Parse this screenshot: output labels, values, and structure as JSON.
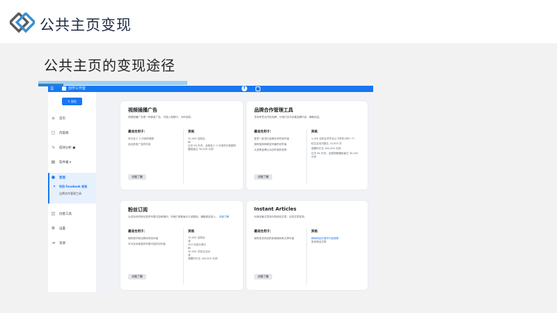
{
  "slide": {
    "header_title": "公共主页变现",
    "page_title": "公共主页的变现途径"
  },
  "app": {
    "brand": "创作工作室",
    "create_button": "发帖",
    "nav": [
      {
        "label": "首页",
        "icon": "home-icon"
      },
      {
        "label": "内容库",
        "icon": "content-library-icon"
      },
      {
        "label": "成效分析 ●",
        "icon": "insights-icon"
      },
      {
        "label": "软件箱 ▾",
        "icon": "toolbox-icon"
      },
      {
        "label": "变现",
        "icon": "monetization-icon"
      },
      {
        "label": "创意工具",
        "icon": "creative-tools-icon"
      },
      {
        "label": "设置",
        "icon": "settings-icon"
      },
      {
        "label": "资源",
        "icon": "resources-icon"
      }
    ],
    "subnav": [
      {
        "label": "利用 Facebook 变现"
      },
      {
        "label": "品牌合作管理工具"
      }
    ]
  },
  "cards": [
    {
      "title": "视频插播广告",
      "desc": "视频插播广告是一种营收广告，可插入视频中，为你创收。",
      "left_head": "最适合用于：",
      "left_lines": [
        "时长至少 3 分钟的视频",
        "适合投放广告的内容"
      ],
      "right_head": "资格",
      "right_lines": [
        "10,000 名粉丝",
        "和",
        "过去 60 天内，全部至少 3 分钟时长视频的播放量达 30,000 分钟"
      ],
      "button": "详细了解"
    },
    {
      "title": "品牌合作管理工具",
      "desc": "寻找有意合作的品牌，与他们合作创建品牌内容，赚取收益。",
      "left_head": "最适合用于：",
      "left_lines": [
        "愿意一起进行品牌合作的创作者",
        "拥有独特和稳定风格的创作者",
        "大多数品牌认为创作者的优势"
      ],
      "right_head": "资格",
      "right_lines": [
        "1,000 名粉丝并符合以下条件中的一个：",
        "帖文互动次数达 15,000 次",
        "观看时长达 180,000 分钟",
        "过去 60 天内，全部视频播放量达 30,000 分钟"
      ],
      "button": "详细了解"
    },
    {
      "title": "粉丝订阅",
      "desc": "为支持你的粉丝提供专属内容和福利，向他们收取每月订阅费用，赚取稳定收入。",
      "desc_link": "详细了解",
      "left_head": "最适合用于：",
      "left_lines": [
        "拥有铁杆粉丝群体的创作者",
        "可为支持者提供专属内容的创作者"
      ],
      "right_head": "资格",
      "right_lines": [
        "10,000 名粉丝",
        "或",
        "250 位回头观众",
        "和",
        "50,000 次帖文互动",
        "或",
        "观看时长达 180,000 分钟"
      ],
      "button": "详细了解"
    },
    {
      "title": "Instant Articles",
      "desc": "利用该格式发布你的网站文章，实现文章变现。",
      "left_head": "最适合用于：",
      "left_lines": [
        "拥有发布网站的新闻媒体和文章作者"
      ],
      "right_head": "资格",
      "right_lines": [
        "拥有网站并遵守内容政策",
        "发布原创文章"
      ],
      "button": "详细了解"
    }
  ],
  "colors": {
    "brand_blue": "#1877f2",
    "accent_light": "#9fd0f0",
    "accent_dark": "#2e84c6",
    "logo_dark": "#4a4a4a",
    "logo_blue": "#3a8fd0"
  }
}
